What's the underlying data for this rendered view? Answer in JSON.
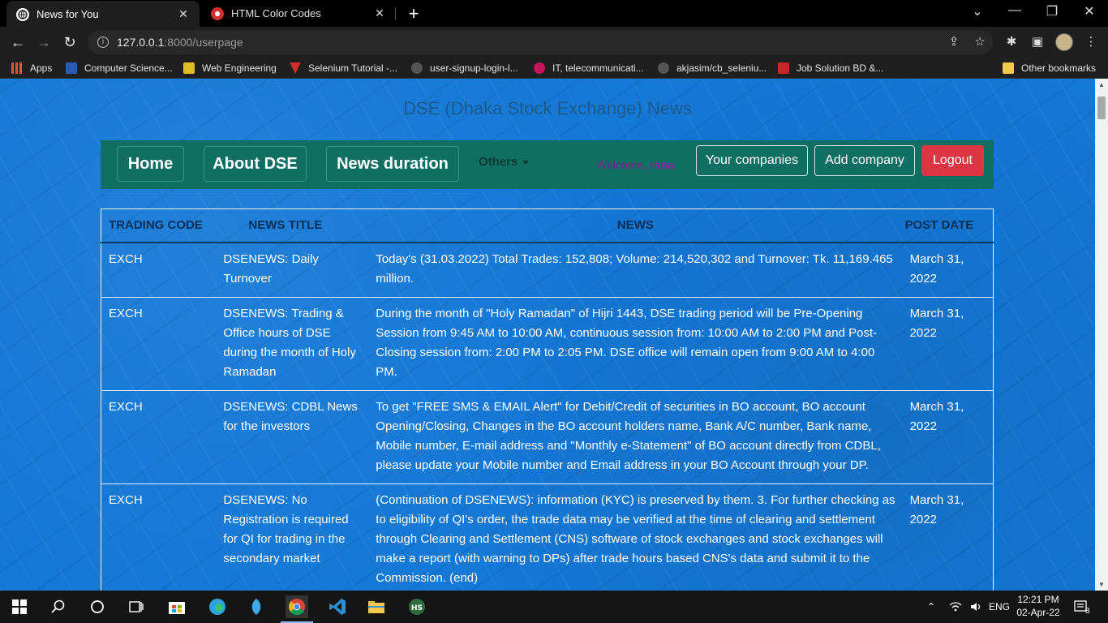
{
  "browser": {
    "tabs": [
      {
        "title": "News for You",
        "close": "✕"
      },
      {
        "title": "HTML Color Codes",
        "close": "✕"
      }
    ],
    "new_tab": "+",
    "window": {
      "minimize": "—",
      "restore": "❐",
      "close": "✕",
      "tab_search": "⌄"
    },
    "nav": {
      "back": "←",
      "forward": "→",
      "reload": "↻"
    },
    "address": {
      "host": "127.0.0.1",
      "rest": ":8000/userpage",
      "info": "i"
    },
    "toolbar_icons": {
      "share": "⇪",
      "star": "☆",
      "extensions": "✱",
      "sidepanel": "▣",
      "menu": "⋮"
    },
    "bookmarks": [
      {
        "label": "Apps",
        "color": "#e4572e"
      },
      {
        "label": "Computer Science...",
        "color": "#2a5db0"
      },
      {
        "label": "Web Engineering",
        "color": "#e0c020"
      },
      {
        "label": "Selenium Tutorial -...",
        "color": "#d32f2f"
      },
      {
        "label": "user-signup-login-l...",
        "color": "#555555"
      },
      {
        "label": "IT, telecommunicati...",
        "color": "#c2185b"
      },
      {
        "label": "akjasim/cb_seleniu...",
        "color": "#555555"
      },
      {
        "label": "Job Solution BD &...",
        "color": "#c62828"
      }
    ],
    "other_bookmarks": "Other bookmarks"
  },
  "page": {
    "title": "DSE (Dhaka Stock Exchange) News",
    "nav": {
      "home": "Home",
      "about": "About DSE",
      "duration": "News duration",
      "others": "Others",
      "welcome_prefix": "Welcome,",
      "username": "rana",
      "your_companies": "Your companies",
      "add_company": "Add company",
      "logout": "Logout"
    },
    "table": {
      "headers": [
        "TRADING CODE",
        "NEWS TITLE",
        "NEWS",
        "POST DATE"
      ],
      "rows": [
        {
          "code": "EXCH",
          "title": "DSENEWS: Daily Turnover",
          "news": "Today's (31.03.2022) Total Trades: 152,808; Volume: 214,520,302 and Turnover: Tk. 11,169.465 million.",
          "date": "March 31, 2022"
        },
        {
          "code": "EXCH",
          "title": "DSENEWS: Trading & Office hours of DSE during the month of Holy Ramadan",
          "news": "During the month of \"Holy Ramadan\" of Hijri 1443, DSE trading period will be Pre-Opening Session from 9:45 AM to 10:00 AM, continuous session from: 10:00 AM to 2:00 PM and Post-Closing session from: 2:00 PM to 2:05 PM. DSE office will remain open from 9:00 AM to 4:00 PM.",
          "date": "March 31, 2022"
        },
        {
          "code": "EXCH",
          "title": "DSENEWS: CDBL News for the investors",
          "news": "To get \"FREE SMS & EMAIL Alert\" for Debit/Credit of securities in BO account, BO account Opening/Closing, Changes in the BO account holders name, Bank A/C number, Bank name, Mobile number, E-mail address and \"Monthly e-Statement\" of BO account directly from CDBL, please update your Mobile number and Email address in your BO Account through your DP.",
          "date": "March 31, 2022"
        },
        {
          "code": "EXCH",
          "title": "DSENEWS: No Registration is required for QI for trading in the secondary market",
          "news": "(Continuation of DSENEWS): information (KYC) is preserved by them. 3. For further checking as to eligibility of QI's order, the trade data may be verified at the time of clearing and settlement through Clearing and Settlement (CNS) software of stock exchanges and stock exchanges will make a report (with warning to DPs) after trade hours based CNS's data and submit it to the Commission. (end)",
          "date": "March 31, 2022"
        }
      ]
    }
  },
  "taskbar": {
    "lang": "ENG",
    "time": "12:21 PM",
    "date": "02-Apr-22",
    "notifications": "8"
  }
}
